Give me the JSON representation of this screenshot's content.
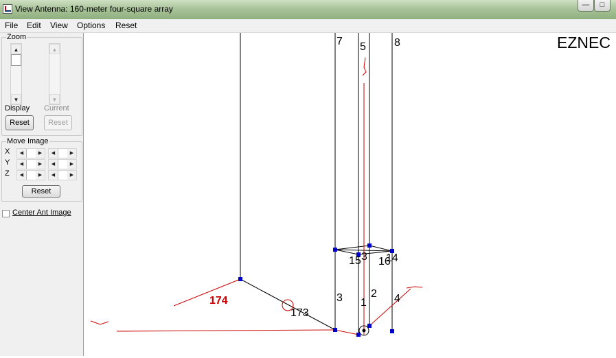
{
  "window": {
    "title": "View Antenna: 160-meter four-square array"
  },
  "menu": [
    "File",
    "Edit",
    "View",
    "Options",
    "Reset"
  ],
  "zoom": {
    "legend": "Zoom",
    "display_label": "Display",
    "current_label": "Current",
    "display_reset": "Reset",
    "current_reset": "Reset"
  },
  "move_image": {
    "legend": "Move Image",
    "axes": [
      "X",
      "Y",
      "Z"
    ],
    "reset": "Reset"
  },
  "center_ant_image": {
    "label": "Center Ant Image",
    "checked": false
  },
  "canvas": {
    "brand": "EZNEC",
    "wire_labels": [
      "7",
      "5",
      "8",
      "3",
      "2",
      "1",
      "4",
      "15",
      "3",
      "16",
      "14",
      "173",
      "174"
    ],
    "accent_red": "#cc0000",
    "wire_color": "#000000",
    "segment_color": "#0000cc"
  }
}
